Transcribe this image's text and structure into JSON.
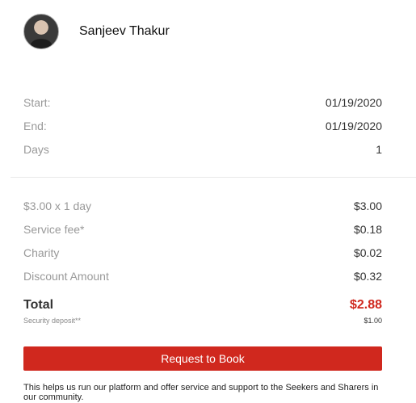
{
  "user": {
    "name": "Sanjeev Thakur"
  },
  "dates": {
    "start_label": "Start:",
    "start_value": "01/19/2020",
    "end_label": "End:",
    "end_value": "01/19/2020",
    "days_label": "Days",
    "days_value": "1"
  },
  "pricing": {
    "rate_label": "$3.00 x 1 day",
    "rate_value": "$3.00",
    "service_label": "Service fee*",
    "service_value": "$0.18",
    "charity_label": "Charity",
    "charity_value": "$0.02",
    "discount_label": "Discount Amount",
    "discount_value": "$0.32",
    "total_label": "Total",
    "total_value": "$2.88",
    "deposit_label": "Security deposit**",
    "deposit_value": "$1.00"
  },
  "actions": {
    "book_label": "Request to Book"
  },
  "footer": {
    "note": "This helps us run our platform and offer service and support to the Seekers and Sharers in our community."
  },
  "colors": {
    "accent": "#d0281e"
  }
}
